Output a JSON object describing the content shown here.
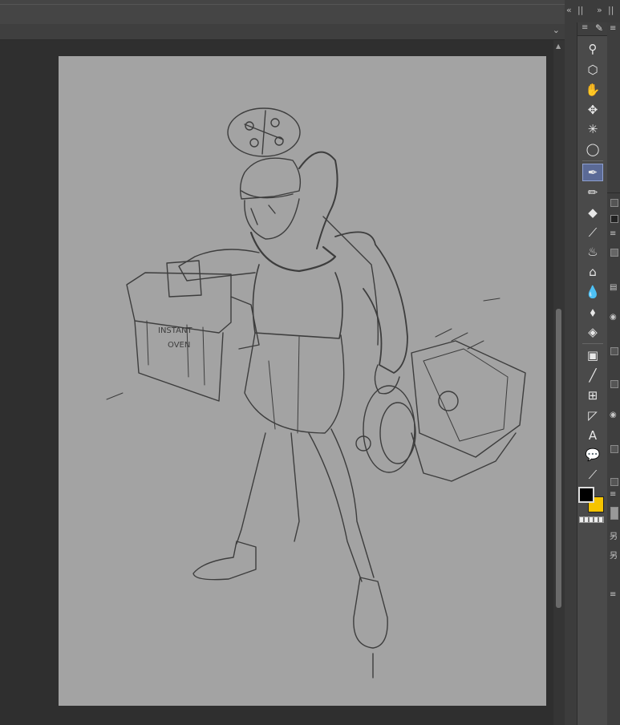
{
  "window": {
    "panel_controls": {
      "collapse_left": "«",
      "collapse_right": "»",
      "grip": "||"
    },
    "tab_dropdown": "⌄"
  },
  "canvas": {
    "background_color": "#a3a3a3",
    "sketch_text": {
      "line1": "INSTANT",
      "line2": "OVEN"
    }
  },
  "toolbar": {
    "menu_icon": "≡",
    "brush_indicator": "✎",
    "selected_tool": "pen",
    "tools": [
      {
        "name": "zoom",
        "glyph": "⚲"
      },
      {
        "name": "operation",
        "glyph": "⬡"
      },
      {
        "name": "hand",
        "glyph": "✋"
      },
      {
        "name": "move",
        "glyph": "✥"
      },
      {
        "name": "auto-select",
        "glyph": "✳"
      },
      {
        "name": "lasso-select",
        "glyph": "◯"
      },
      {
        "name": "pen",
        "glyph": "✒"
      },
      {
        "name": "pencil",
        "glyph": "✏"
      },
      {
        "name": "eraser",
        "glyph": "◆"
      },
      {
        "name": "eyedropper",
        "glyph": "⟋"
      },
      {
        "name": "airbrush",
        "glyph": "♨"
      },
      {
        "name": "decoration",
        "glyph": "⌂"
      },
      {
        "name": "blend",
        "glyph": "💧"
      },
      {
        "name": "brush",
        "glyph": "⬧"
      },
      {
        "name": "fill",
        "glyph": "◈"
      },
      {
        "name": "gradient",
        "glyph": "▣"
      },
      {
        "name": "figure",
        "glyph": "╱"
      },
      {
        "name": "frame-border",
        "glyph": "⊞"
      },
      {
        "name": "ruler",
        "glyph": "◸"
      },
      {
        "name": "text",
        "glyph": "A"
      },
      {
        "name": "balloon",
        "glyph": "💬"
      },
      {
        "name": "correct-line",
        "glyph": "⟋"
      }
    ],
    "colors": {
      "main": "#000000",
      "sub": "#f5c400"
    }
  },
  "right_strip": {
    "labels": [
      "另",
      "另",
      "≡",
      "≡"
    ]
  }
}
